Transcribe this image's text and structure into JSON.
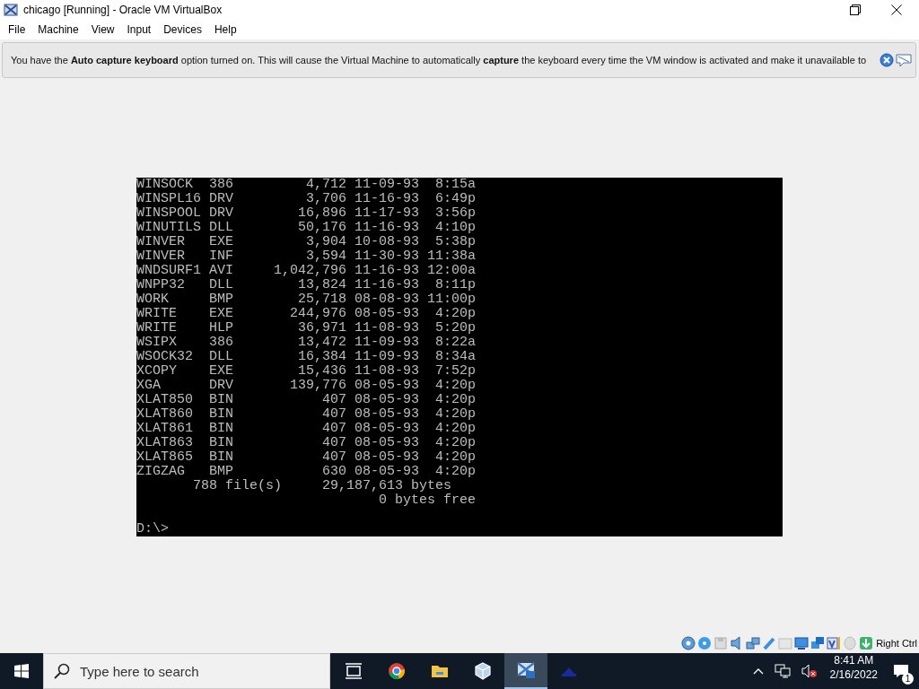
{
  "window": {
    "title": "chicago [Running] - Oracle VM VirtualBox"
  },
  "menu": [
    {
      "label": "File"
    },
    {
      "label": "Machine"
    },
    {
      "label": "View"
    },
    {
      "label": "Input"
    },
    {
      "label": "Devices"
    },
    {
      "label": "Help"
    }
  ],
  "notice": {
    "text": "You have the **Auto capture keyboard** option turned on. This will cause the Virtual Machine to automatically **capture** the keyboard every time the VM window is activated and make it unavailable to"
  },
  "dos": {
    "files": [
      {
        "name": "WINSOCK",
        "ext": "386",
        "size": "4,712",
        "date": "11-09-93",
        "time": "8:15a"
      },
      {
        "name": "WINSPL16",
        "ext": "DRV",
        "size": "3,706",
        "date": "11-16-93",
        "time": "6:49p"
      },
      {
        "name": "WINSPOOL",
        "ext": "DRV",
        "size": "16,896",
        "date": "11-17-93",
        "time": "3:56p"
      },
      {
        "name": "WINUTILS",
        "ext": "DLL",
        "size": "50,176",
        "date": "11-16-93",
        "time": "4:10p"
      },
      {
        "name": "WINVER",
        "ext": "EXE",
        "size": "3,904",
        "date": "10-08-93",
        "time": "5:38p"
      },
      {
        "name": "WINVER",
        "ext": "INF",
        "size": "3,594",
        "date": "11-30-93",
        "time": "11:38a"
      },
      {
        "name": "WNDSURF1",
        "ext": "AVI",
        "size": "1,042,796",
        "date": "11-16-93",
        "time": "12:00a"
      },
      {
        "name": "WNPP32",
        "ext": "DLL",
        "size": "13,824",
        "date": "11-16-93",
        "time": "8:11p"
      },
      {
        "name": "WORK",
        "ext": "BMP",
        "size": "25,718",
        "date": "08-08-93",
        "time": "11:00p"
      },
      {
        "name": "WRITE",
        "ext": "EXE",
        "size": "244,976",
        "date": "08-05-93",
        "time": "4:20p"
      },
      {
        "name": "WRITE",
        "ext": "HLP",
        "size": "36,971",
        "date": "11-08-93",
        "time": "5:20p"
      },
      {
        "name": "WSIPX",
        "ext": "386",
        "size": "13,472",
        "date": "11-09-93",
        "time": "8:22a"
      },
      {
        "name": "WSOCK32",
        "ext": "DLL",
        "size": "16,384",
        "date": "11-09-93",
        "time": "8:34a"
      },
      {
        "name": "XCOPY",
        "ext": "EXE",
        "size": "15,436",
        "date": "11-08-93",
        "time": "7:52p"
      },
      {
        "name": "XGA",
        "ext": "DRV",
        "size": "139,776",
        "date": "08-05-93",
        "time": "4:20p"
      },
      {
        "name": "XLAT850",
        "ext": "BIN",
        "size": "407",
        "date": "08-05-93",
        "time": "4:20p"
      },
      {
        "name": "XLAT860",
        "ext": "BIN",
        "size": "407",
        "date": "08-05-93",
        "time": "4:20p"
      },
      {
        "name": "XLAT861",
        "ext": "BIN",
        "size": "407",
        "date": "08-05-93",
        "time": "4:20p"
      },
      {
        "name": "XLAT863",
        "ext": "BIN",
        "size": "407",
        "date": "08-05-93",
        "time": "4:20p"
      },
      {
        "name": "XLAT865",
        "ext": "BIN",
        "size": "407",
        "date": "08-05-93",
        "time": "4:20p"
      },
      {
        "name": "ZIGZAG",
        "ext": "BMP",
        "size": "630",
        "date": "08-05-93",
        "time": "4:20p"
      }
    ],
    "file_count": "788 file(s)",
    "total_bytes": "29,187,613 bytes",
    "free": "0 bytes free",
    "prompt": "D:\\>"
  },
  "status_bar": {
    "host_key": "Right Ctrl"
  },
  "taskbar": {
    "search": {
      "placeholder": "Type here to search"
    },
    "apps": [
      {
        "kind": "taskview",
        "selected": false
      },
      {
        "kind": "chrome",
        "selected": false
      },
      {
        "kind": "explorer",
        "selected": false
      },
      {
        "kind": "virtualbox",
        "selected": false
      },
      {
        "kind": "win95",
        "selected": true
      },
      {
        "kind": "bluewin",
        "selected": false
      }
    ],
    "clock": {
      "time": "8:41 AM",
      "date": "2/16/2022"
    },
    "notifications": "1"
  }
}
